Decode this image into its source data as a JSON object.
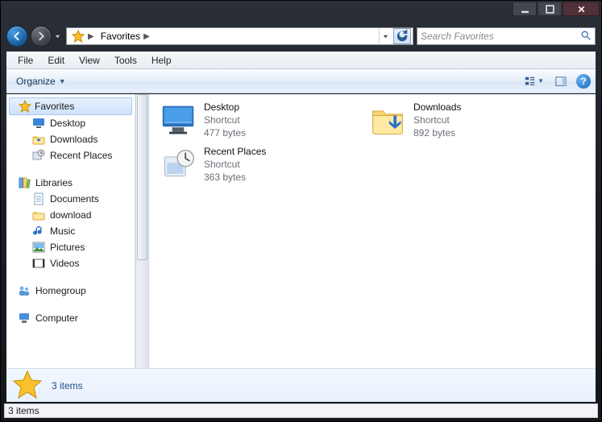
{
  "address": {
    "location": "Favorites"
  },
  "search": {
    "placeholder": "Search Favorites"
  },
  "menu": {
    "file": "File",
    "edit": "Edit",
    "view": "View",
    "tools": "Tools",
    "help": "Help"
  },
  "toolbar": {
    "organize": "Organize"
  },
  "sidebar": {
    "favorites": {
      "label": "Favorites",
      "items": [
        {
          "label": "Desktop"
        },
        {
          "label": "Downloads"
        },
        {
          "label": "Recent Places"
        }
      ]
    },
    "libraries": {
      "label": "Libraries",
      "items": [
        {
          "label": "Documents"
        },
        {
          "label": "download"
        },
        {
          "label": "Music"
        },
        {
          "label": "Pictures"
        },
        {
          "label": "Videos"
        }
      ]
    },
    "homegroup": {
      "label": "Homegroup"
    },
    "computer": {
      "label": "Computer"
    }
  },
  "items": [
    {
      "name": "Desktop",
      "type": "Shortcut",
      "size": "477 bytes"
    },
    {
      "name": "Downloads",
      "type": "Shortcut",
      "size": "892 bytes"
    },
    {
      "name": "Recent Places",
      "type": "Shortcut",
      "size": "363 bytes"
    }
  ],
  "details": {
    "summary": "3 items"
  },
  "status": {
    "text": "3 items"
  }
}
